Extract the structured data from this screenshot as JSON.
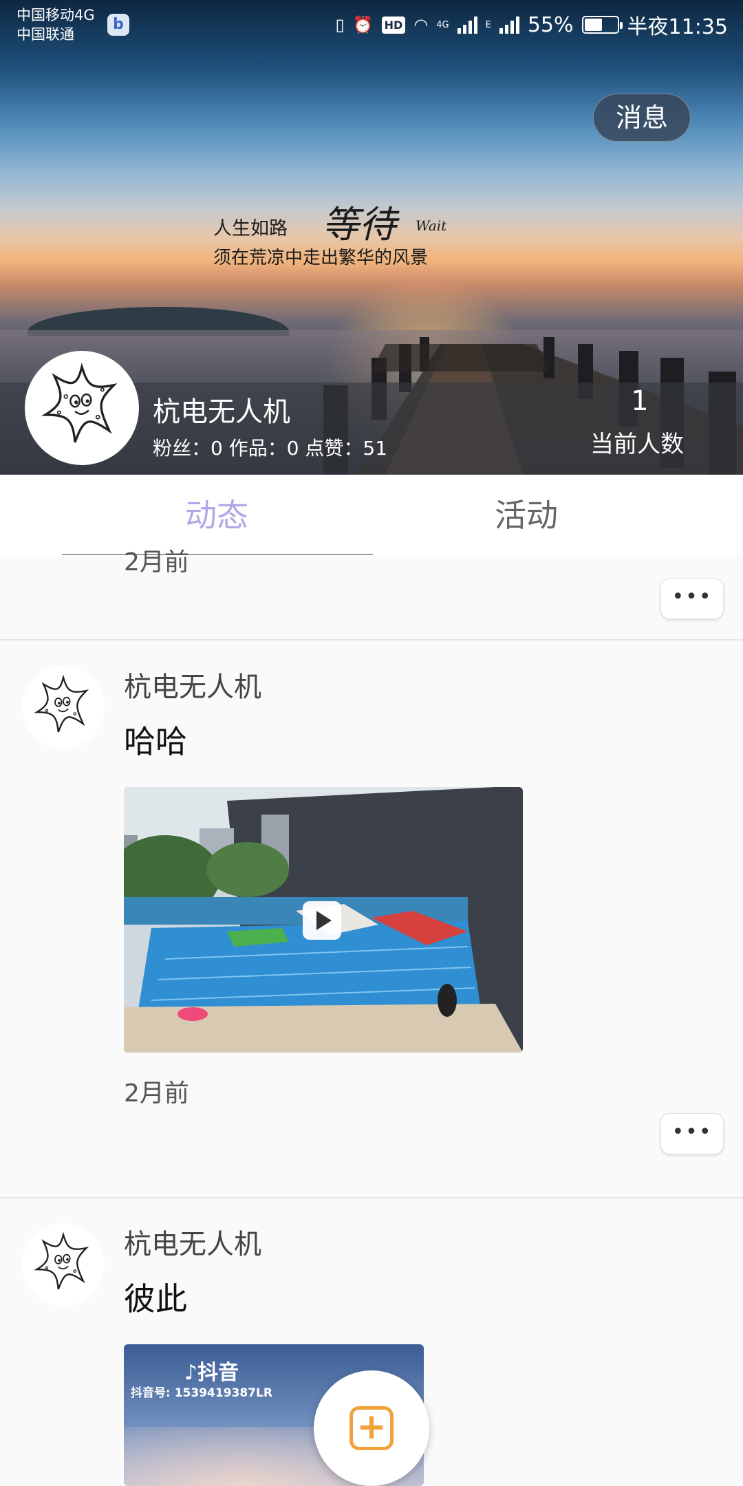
{
  "status_bar": {
    "carrier_1": "中国移动4G",
    "carrier_2": "中国联通",
    "app_badge": "b",
    "hd": "HD",
    "net_4g": "4G",
    "net_e": "E",
    "battery": "55%",
    "battery_level": 0.55,
    "time": "半夜11:35"
  },
  "header": {
    "message_button": "消息",
    "quote_line1": "人生如路",
    "quote_script": "等待",
    "quote_wait": "Wait",
    "quote_line2": "须在荒凉中走出繁华的风景",
    "user_name": "杭电无人机",
    "stats": "粉丝：0 作品：0 点赞：51",
    "online_count": "1",
    "online_label": "当前人数"
  },
  "tabs": [
    {
      "label": "动态",
      "active": true
    },
    {
      "label": "活动",
      "active": false
    }
  ],
  "feed": {
    "partial_post": {
      "time": "2月前",
      "more": "•••"
    },
    "posts": [
      {
        "author": "杭电无人机",
        "text": "哈哈",
        "media": "video",
        "time": "2月前",
        "more": "•••"
      },
      {
        "author": "杭电无人机",
        "text": "彼此",
        "media": "image",
        "watermark_logo": "♪抖音",
        "watermark_id": "抖音号: 1539419387LR"
      }
    ]
  },
  "fab": {
    "icon": "plus-square-icon",
    "glyph": "+"
  },
  "colors": {
    "active_tab": "#b3a6e6",
    "fab_accent": "#f1a23a"
  }
}
